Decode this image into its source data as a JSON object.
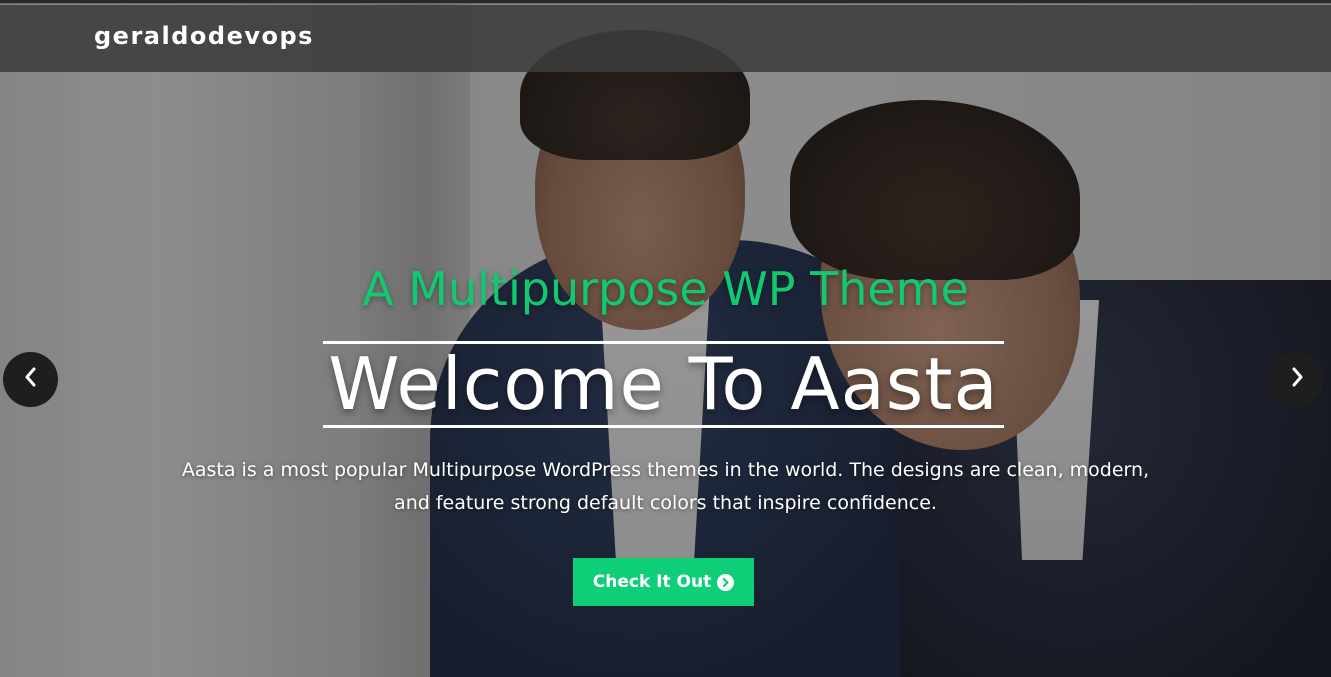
{
  "site": {
    "brand": "geraldodevops"
  },
  "hero": {
    "subtitle": "A Multipurpose WP Theme",
    "title": "Welcome To Aasta",
    "description": "Aasta is a most popular Multipurpose WordPress themes in the world. The designs are clean, modern, and feature strong default colors that inspire confidence.",
    "cta_label": "Check It Out",
    "cta_icon": "chevron-circle-right-icon",
    "prev_icon": "chevron-left-icon",
    "next_icon": "chevron-right-icon"
  },
  "colors": {
    "accent": "#0ecf78",
    "subtitle": "#10c971",
    "header_bg": "#3c3c3c",
    "arrow_bg": "#1e1e1e"
  }
}
